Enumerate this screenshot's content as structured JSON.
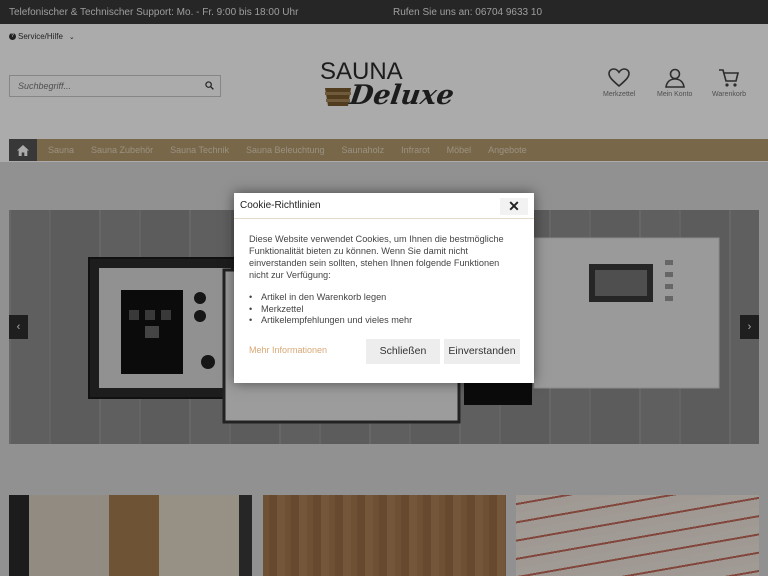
{
  "topbar": {
    "support": "Telefonischer & Technischer Support: Mo. - Fr. 9:00 bis 18:00 Uhr",
    "phone": "Rufen Sie uns an: 06704 9633 10"
  },
  "service": {
    "label": "Service/Hilfe"
  },
  "search": {
    "placeholder": "Suchbegriff..."
  },
  "logo": {
    "line1": "SAUNA",
    "line2": "Deluxe"
  },
  "header_icons": {
    "wishlist": "Merkzettel",
    "account": "Mein Konto",
    "cart": "Warenkorb"
  },
  "nav": {
    "items": [
      "Sauna",
      "Sauna Zubehör",
      "Sauna Technik",
      "Sauna Beleuchtung",
      "Saunaholz",
      "Infrarot",
      "Möbel",
      "Angebote"
    ]
  },
  "slider": {
    "prev": "‹",
    "next": "›"
  },
  "cookie": {
    "title": "Cookie-Richtlinien",
    "close": "✕",
    "text": "Diese Website verwendet Cookies, um Ihnen die bestmögliche Funktionalität bieten zu können. Wenn Sie damit nicht einverstanden sein sollten, stehen Ihnen folgende Funktionen nicht zur Verfügung:",
    "items": [
      "Artikel in den Warenkorb legen",
      "Merkzettel",
      "Artikelempfehlungen und vieles mehr"
    ],
    "more": "Mehr Informationen",
    "close_button": "Schließen",
    "accept_button": "Einverstanden"
  },
  "colors": {
    "topbar": "#3a3a3a",
    "nav": "#b59a6d",
    "accent_link": "#d8a876"
  }
}
